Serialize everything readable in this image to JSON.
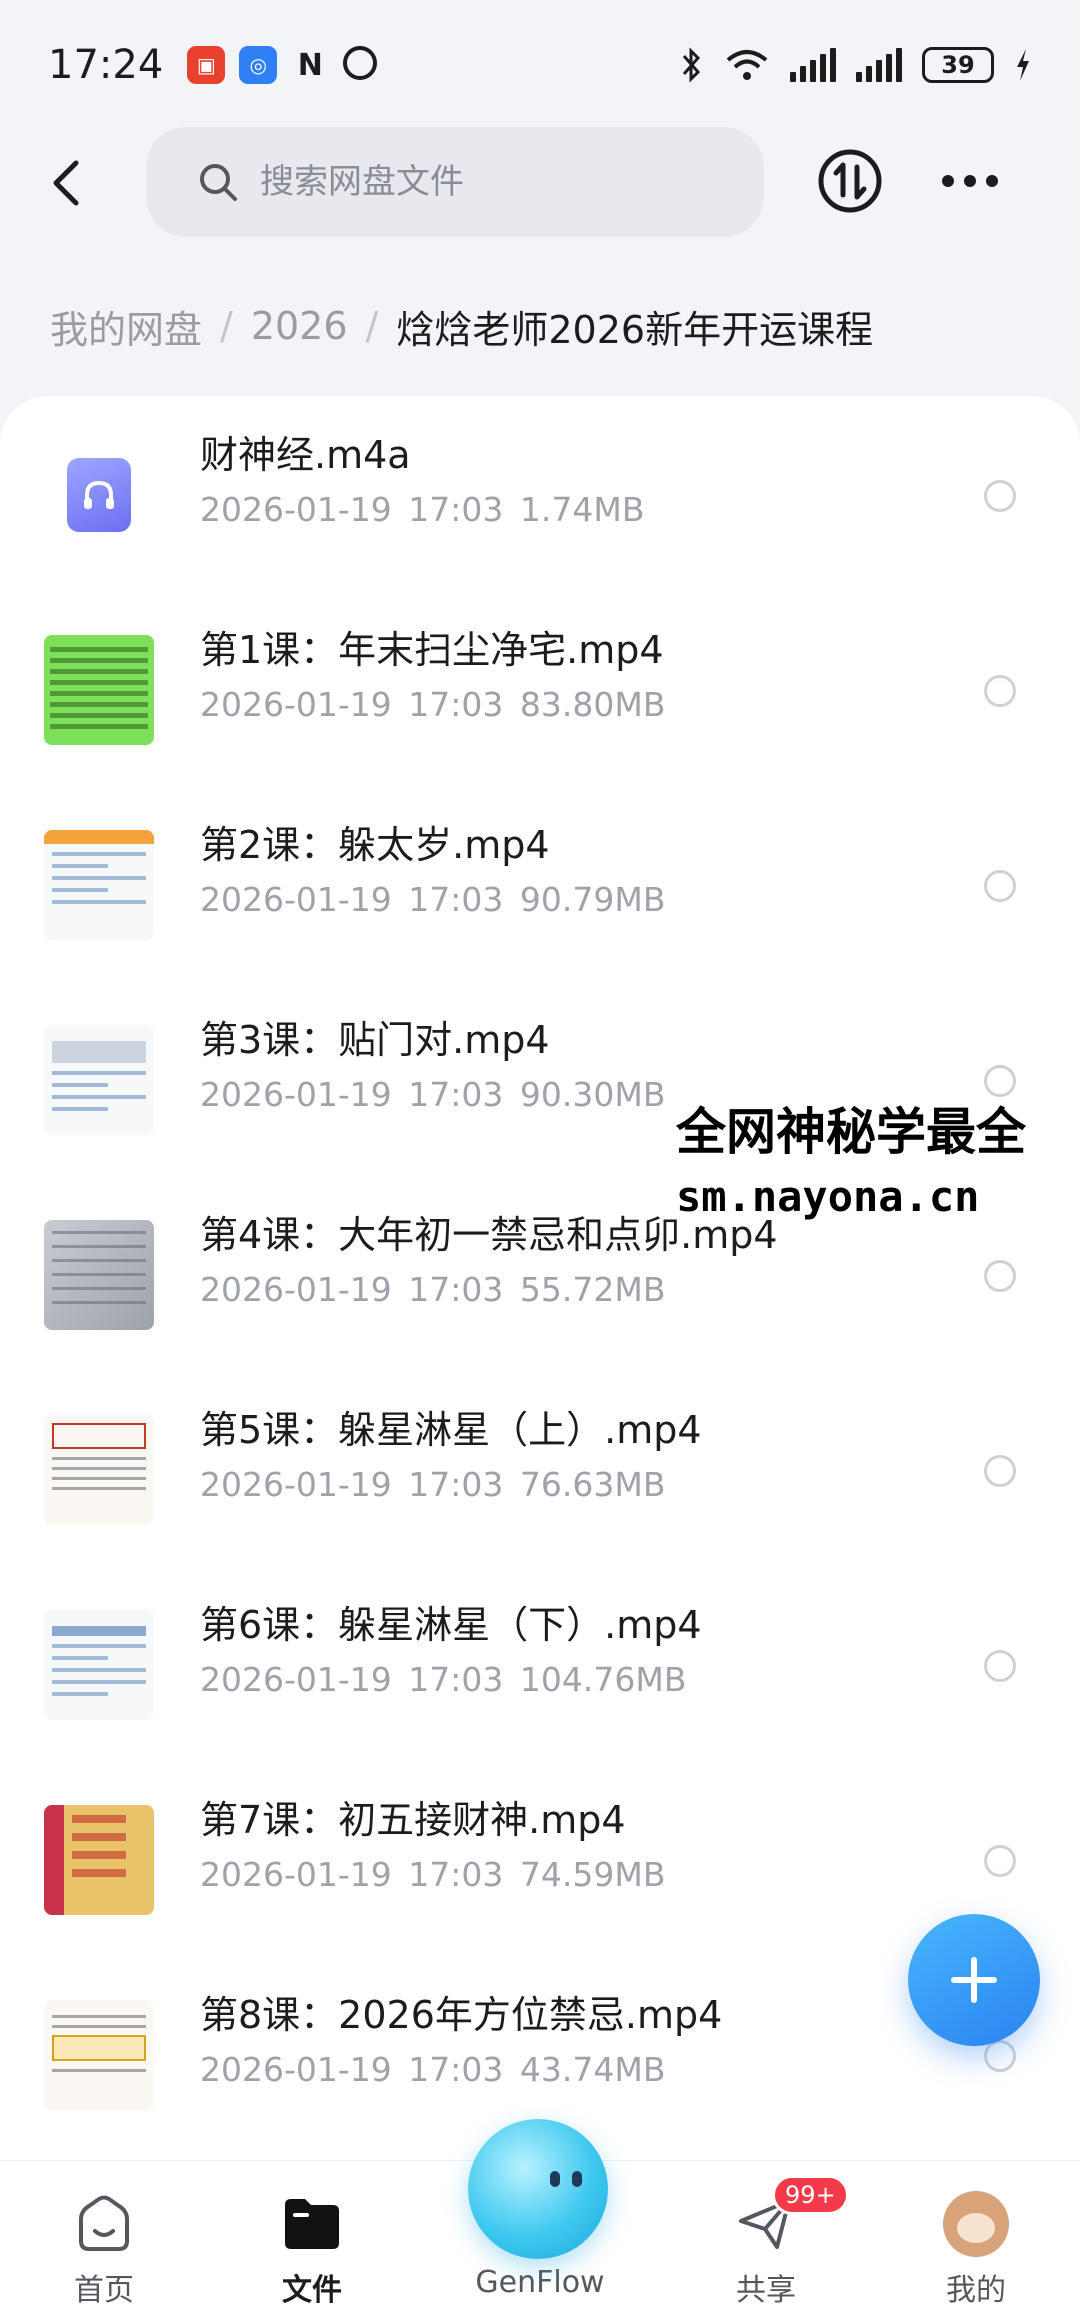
{
  "status": {
    "time": "17:24",
    "battery": "39"
  },
  "search": {
    "placeholder": "搜索网盘文件"
  },
  "breadcrumb": {
    "root": "我的网盘",
    "year": "2026",
    "current": "焓焓老师2026新年开运课程",
    "sep": "/"
  },
  "files": [
    {
      "name": "财神经.m4a",
      "date": "2026-01-19",
      "time": "17:03",
      "size": "1.74MB",
      "thumb": "audio-icon"
    },
    {
      "name": "第1课：年末扫尘净宅.mp4",
      "date": "2026-01-19",
      "time": "17:03",
      "size": "83.80MB",
      "thumb": "green-note-thumbnail"
    },
    {
      "name": "第2课：躲太岁.mp4",
      "date": "2026-01-19",
      "time": "17:03",
      "size": "90.79MB",
      "thumb": "document-thumbnail"
    },
    {
      "name": "第3课：贴门对.mp4",
      "date": "2026-01-19",
      "time": "17:03",
      "size": "90.30MB",
      "thumb": "document-thumbnail"
    },
    {
      "name": "第4课：大年初一禁忌和点卯.mp4",
      "date": "2026-01-19",
      "time": "17:03",
      "size": "55.72MB",
      "thumb": "paper-thumbnail"
    },
    {
      "name": "第5课：躲星淋星（上）.mp4",
      "date": "2026-01-19",
      "time": "17:03",
      "size": "76.63MB",
      "thumb": "calligraphy-thumbnail"
    },
    {
      "name": "第6课：躲星淋星（下）.mp4",
      "date": "2026-01-19",
      "time": "17:03",
      "size": "104.76MB",
      "thumb": "table-thumbnail"
    },
    {
      "name": "第7课：初五接财神.mp4",
      "date": "2026-01-19",
      "time": "17:03",
      "size": "74.59MB",
      "thumb": "talisman-thumbnail"
    },
    {
      "name": "第8课：2026年方位禁忌.mp4",
      "date": "2026-01-19",
      "time": "17:03",
      "size": "43.74MB",
      "thumb": "chart-thumbnail"
    }
  ],
  "watermark": {
    "line1": "全网神秘学最全",
    "line2": "sm.nayona.cn"
  },
  "nav": {
    "home": "首页",
    "files": "文件",
    "genflow": "GenFlow",
    "share": "共享",
    "share_badge": "99+",
    "me": "我的"
  },
  "colors": {
    "accent": "#2a82f0",
    "badge": "#f23a4a"
  }
}
